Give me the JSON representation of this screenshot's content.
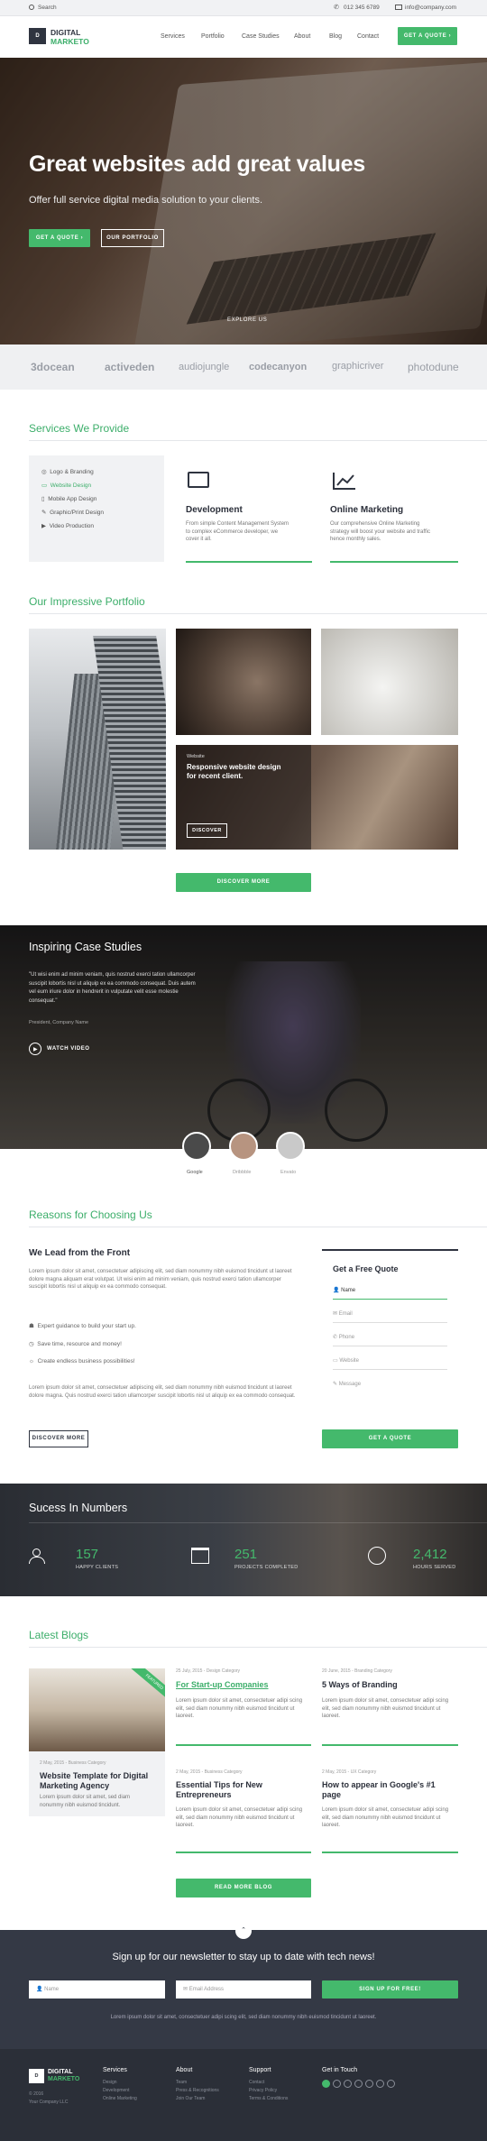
{
  "topbar": {
    "search": "Search",
    "phone": "012 345 6789",
    "email": "info@company.com"
  },
  "header": {
    "logo_line1": "DIGITAL",
    "logo_line2": "MARKETO",
    "nav": [
      "Services",
      "Portfolio",
      "Case Studies",
      "About",
      "Blog",
      "Contact"
    ],
    "cta": "GET A QUOTE"
  },
  "hero": {
    "title": "Great websites add great values",
    "subtitle": "Offer full service digital media solution to your clients.",
    "btn_quote": "GET A QUOTE",
    "btn_portfolio": "OUR PORTFOLIO",
    "explore": "EXPLORE US"
  },
  "brands": [
    "3docean",
    "activeden",
    "audiojungle",
    "codecanyon",
    "graphicriver",
    "photodune"
  ],
  "services": {
    "title": "Services We Provide",
    "list": [
      "Logo & Branding",
      "Website Design",
      "Mobile App Design",
      "Graphic/Print Design",
      "Video Production"
    ],
    "active_index": 1,
    "cards": [
      {
        "title": "Development",
        "text": "From simple Content Management System to complex eCommerce developer, we cover it all."
      },
      {
        "title": "Online Marketing",
        "text": "Our comprehensive Online Marketing strategy will boost your website and traffic hence monthly sales."
      }
    ]
  },
  "portfolio": {
    "title": "Our Impressive Portfolio",
    "overlay_cat": "Website",
    "overlay_text": "Responsive website design for recent client.",
    "overlay_btn": "DISCOVER",
    "btn": "DISCOVER MORE"
  },
  "case": {
    "title": "Inspiring Case Studies",
    "quote": "\"Ut wisi enim ad minim veniam, quis nostrud exerci tation ullamcorper suscipit lobortis nisl ut aliquip ex ea commodo consequat. Duis autem vel eum iriure dolor in hendrerit in vulputate velit esse molestie consequat.\"",
    "author": "President, Company Name",
    "video": "WATCH VIDEO",
    "avatars": [
      "Google",
      "Dribbble",
      "Envato"
    ]
  },
  "reasons": {
    "title": "Reasons for Choosing Us",
    "heading": "We Lead from the Front",
    "para1": "Lorem ipsum dolor sit amet, consectetuer adipiscing elit, sed diam nonummy nibh euismod tincidunt ut laoreet dolore magna aliquam erat volutpat. Ut wisi enim ad minim veniam, quis nostrud exerci tation ullamcorper suscipit lobortis nisl ut aliquip ex ea commodo consequat.",
    "bullets": [
      "Expert guidance to build your start up.",
      "Save time, resource and money!",
      "Create endless business possibilities!"
    ],
    "para2": "Lorem ipsum dolor sit amet, consectetuer adipiscing elit, sed diam nonummy nibh euismod tincidunt ut laoreet dolore magna. Quis nostrud exerci tation ullamcorper suscipit lobortis nisl ut aliquip ex ea commodo consequat.",
    "btn": "DISCOVER MORE",
    "form": {
      "title": "Get a Free Quote",
      "fields": [
        "Name",
        "Email",
        "Phone",
        "Website",
        "Message"
      ],
      "submit": "GET A QUOTE"
    }
  },
  "numbers": {
    "title": "Sucess In Numbers",
    "items": [
      {
        "value": "157",
        "label": "HAPPY CLIENTS"
      },
      {
        "value": "251",
        "label": "PROJECTS COMPLETED"
      },
      {
        "value": "2,412",
        "label": "HOURS SERVED"
      }
    ]
  },
  "blogs": {
    "title": "Latest Blogs",
    "featured": {
      "ribbon": "FEATURED",
      "meta": "2 May, 2015 - Business Category",
      "title": "Website Template for Digital Marketing Agency",
      "text": "Lorem ipsum dolor sit amet, sed diam nonummy nibh euismod tincidunt."
    },
    "posts": [
      {
        "meta": "25 July, 2015 - Design Category",
        "title": "For Start-up Companies",
        "text": "Lorem ipsum dolor sit amet, consectetuer adipi scing elit, sed diam nonummy nibh euismod tincidunt ut laoreet."
      },
      {
        "meta": "20 June, 2015 - Branding Category",
        "title": "5 Ways of Branding",
        "text": "Lorem ipsum dolor sit amet, consectetuer adipi scing elit, sed diam nonummy nibh euismod tincidunt ut laoreet."
      },
      {
        "meta": "2 May, 2015 - Business Category",
        "title": "Essential Tips for New Entrepreneurs",
        "text": "Lorem ipsum dolor sit amet, consectetuer adipi scing elit, sed diam nonummy nibh euismod tincidunt ut laoreet."
      },
      {
        "meta": "2 May, 2015 - UX Category",
        "title": "How to appear in Google's #1 page",
        "text": "Lorem ipsum dolor sit amet, consectetuer adipi scing elit, sed diam nonummy nibh euismod tincidunt ut laoreet."
      }
    ],
    "btn": "READ MORE BLOG"
  },
  "newsletter": {
    "title": "Sign up for our newsletter to stay up to date with tech news!",
    "name_ph": "Name",
    "email_ph": "Email Address",
    "btn": "SIGN UP FOR FREE!",
    "note": "Lorem ipsum dolor sit amet, consectetuer adipi scing elit, sed diam nonummy nibh euismod tincidunt ut laoreet."
  },
  "footer": {
    "logo_line1": "DIGITAL",
    "logo_line2": "MARKETO",
    "copy1": "© 2016",
    "copy2": "Your Company LLC",
    "cols": [
      {
        "title": "Services",
        "items": [
          "Design",
          "Development",
          "Online Marketing"
        ]
      },
      {
        "title": "About",
        "items": [
          "Team",
          "Press & Recognitions",
          "Join Our Team"
        ]
      },
      {
        "title": "Support",
        "items": [
          "Contact",
          "Privacy Policy",
          "Terms & Conditions"
        ]
      }
    ],
    "touch": "Get in Touch"
  },
  "colors": {
    "accent": "#44b96c",
    "dark": "#343945",
    "footer": "#2b2f38"
  }
}
